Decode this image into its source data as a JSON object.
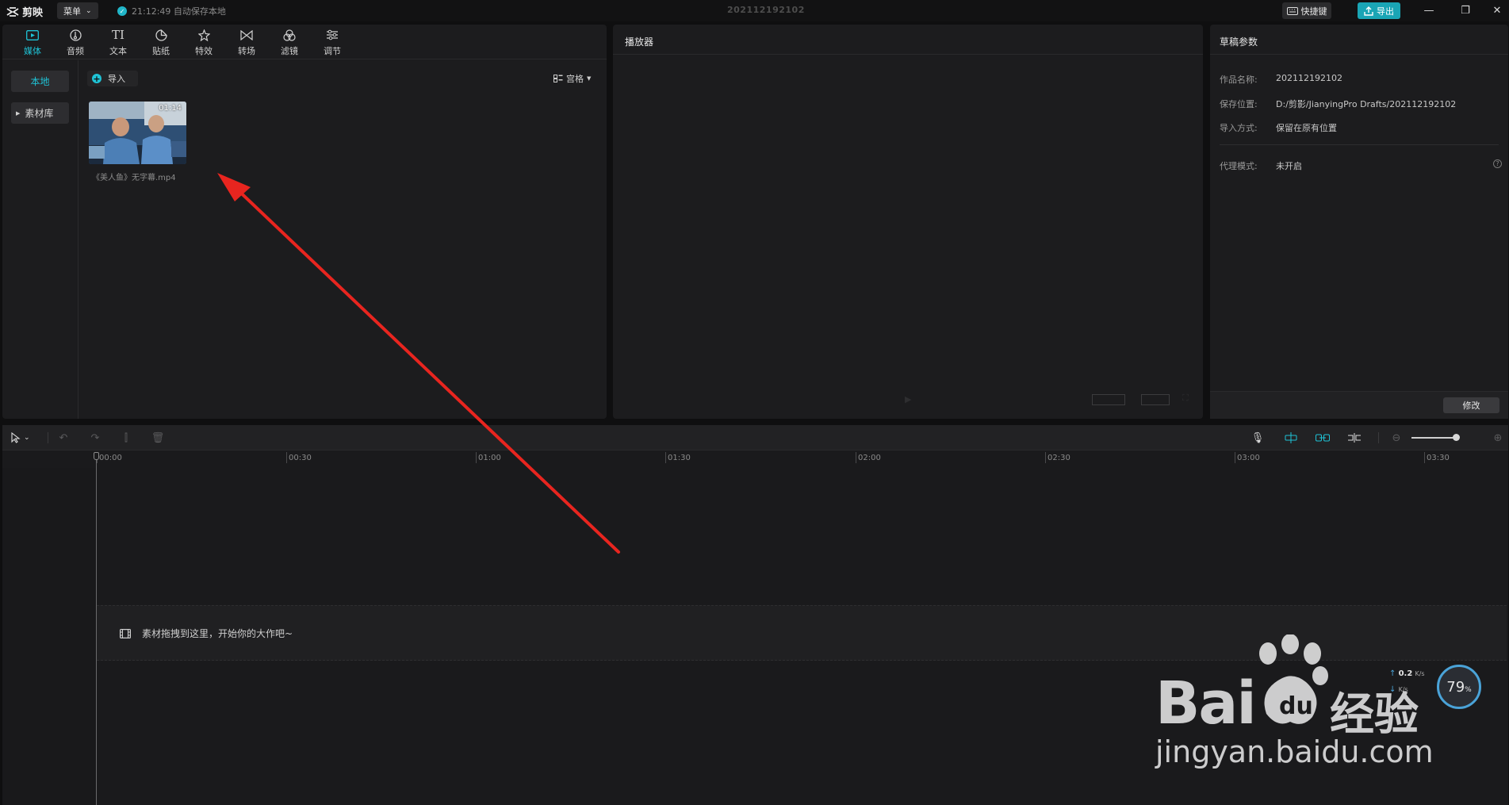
{
  "app": {
    "logo_text": "剪映",
    "menu_label": "菜单",
    "autosave_text": "21:12:49 自动保存本地",
    "project_title": "202112192102",
    "shortcut_label": "快捷键",
    "export_label": "导出"
  },
  "media_tabs": [
    {
      "label": "媒体",
      "icon": "media-icon"
    },
    {
      "label": "音频",
      "icon": "audio-icon"
    },
    {
      "label": "文本",
      "icon": "text-icon"
    },
    {
      "label": "贴纸",
      "icon": "sticker-icon"
    },
    {
      "label": "特效",
      "icon": "effects-icon"
    },
    {
      "label": "转场",
      "icon": "transition-icon"
    },
    {
      "label": "滤镜",
      "icon": "filter-icon"
    },
    {
      "label": "调节",
      "icon": "adjust-icon"
    }
  ],
  "media_sidebar": {
    "local_label": "本地",
    "library_label": "素材库"
  },
  "media": {
    "import_label": "导入",
    "view_label": "宫格",
    "clip": {
      "duration": "01:14",
      "name": "《美人鱼》无字幕.mp4"
    }
  },
  "player": {
    "title": "播放器"
  },
  "props": {
    "title": "草稿参数",
    "rows": [
      {
        "key": "作品名称:",
        "value": "202112192102"
      },
      {
        "key": "保存位置:",
        "value": "D:/剪影/JianyingPro Drafts/202112192102"
      },
      {
        "key": "导入方式:",
        "value": "保留在原有位置"
      },
      {
        "key": "代理模式:",
        "value": "未开启"
      }
    ],
    "modify_label": "修改"
  },
  "timeline": {
    "ticks": [
      "00:00",
      "00:30",
      "01:00",
      "01:30",
      "02:00",
      "02:30",
      "03:00",
      "03:30"
    ],
    "drop_hint": "素材拖拽到这里，开始你的大作吧~"
  },
  "net_widget": {
    "up": "0.2",
    "up_unit": "K/s",
    "down_unit": "K/s",
    "percent": "79",
    "percent_sign": "%"
  },
  "watermark": {
    "brand": "Bai",
    "brand2": "du",
    "cn": "经验",
    "url": "jingyan.baidu.com"
  },
  "colors": {
    "accent": "#1fc3d6",
    "export": "#1aa5b5",
    "arrow": "#e8251f",
    "panel": "#1c1c1e",
    "background": "#0f0f10"
  }
}
